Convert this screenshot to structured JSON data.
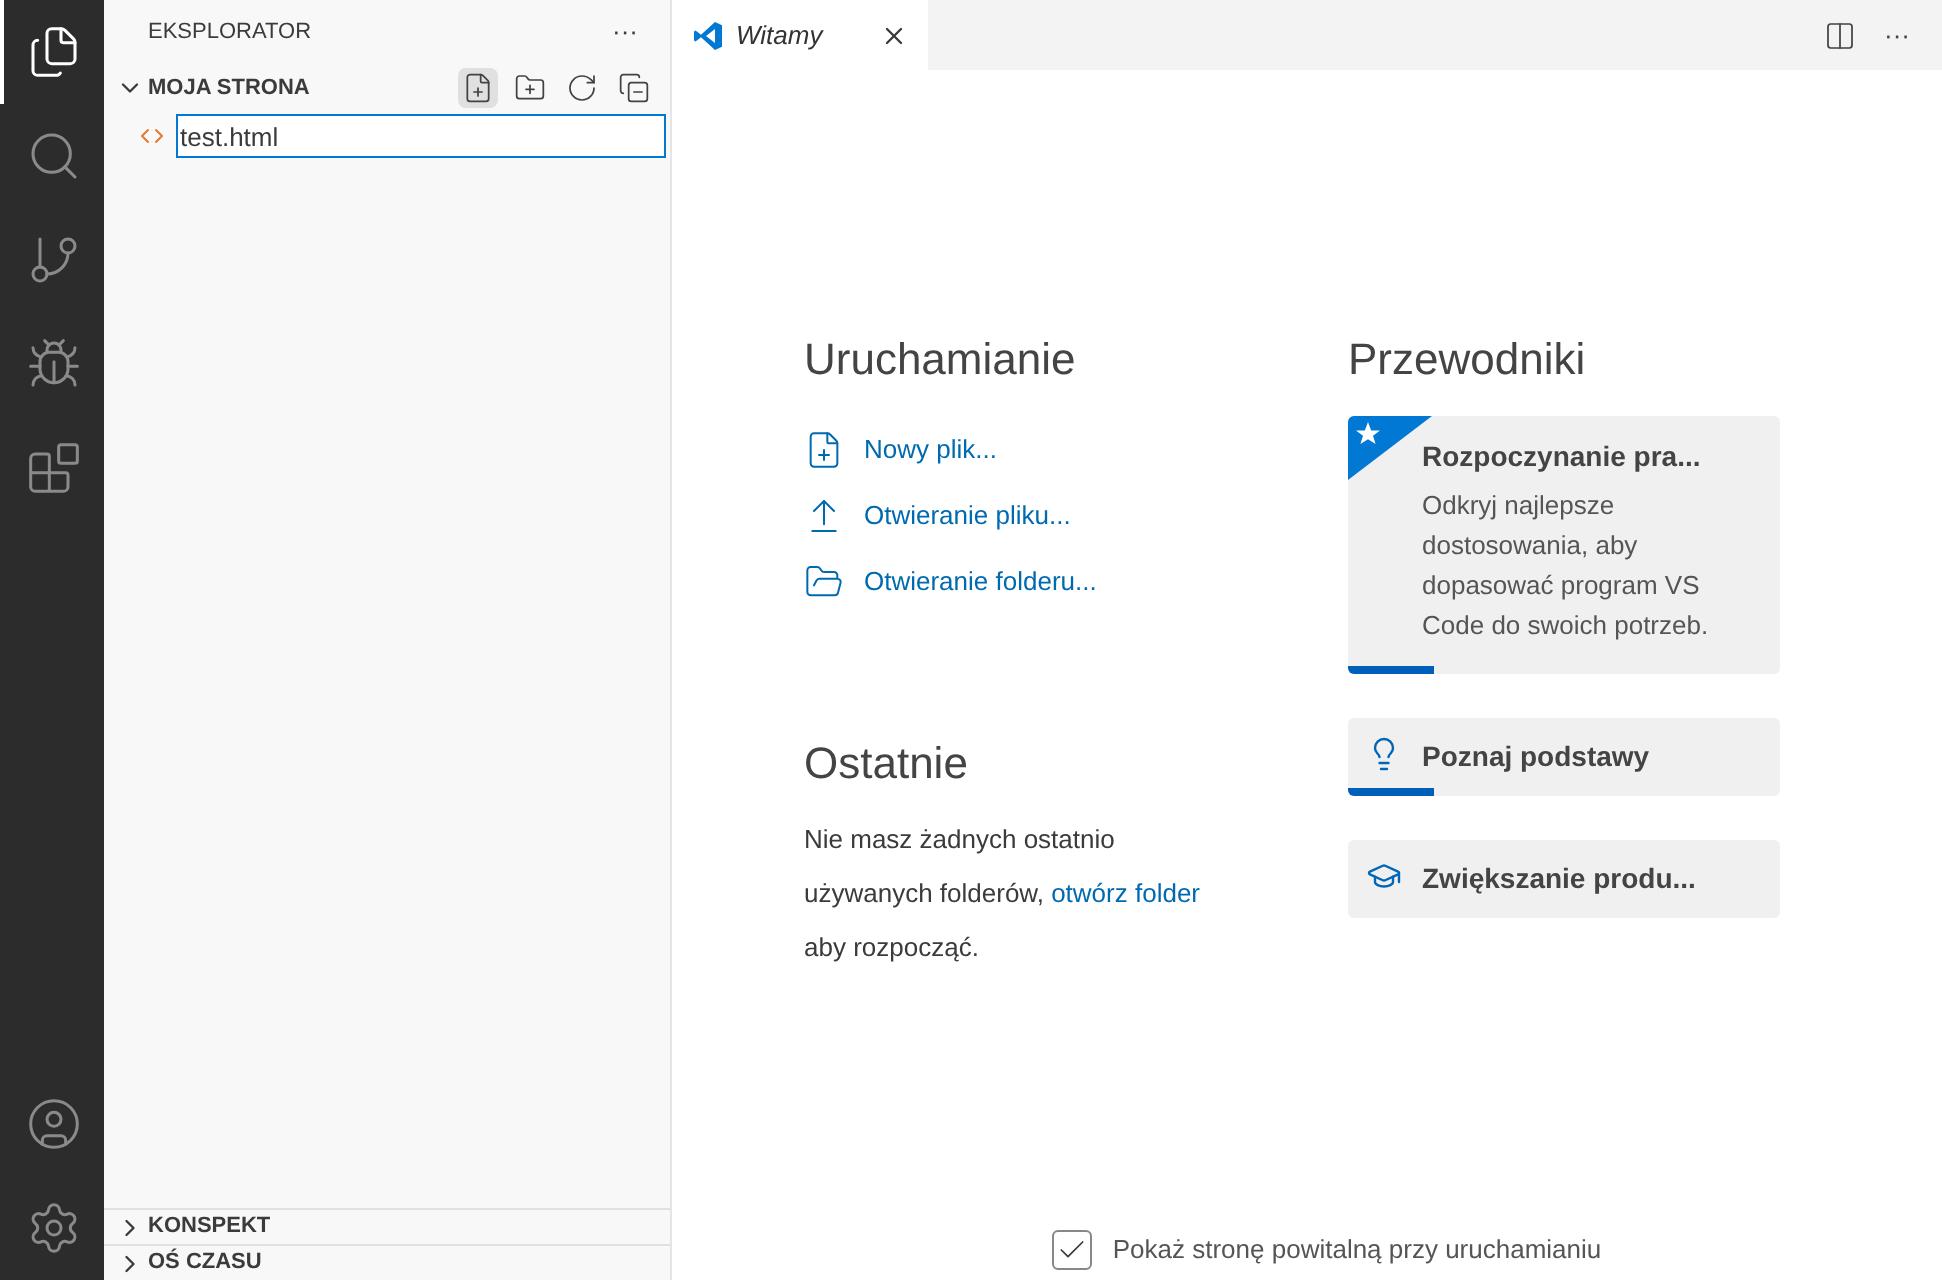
{
  "activity_bar": [
    {
      "kind": "files",
      "selected": true
    },
    {
      "kind": "search",
      "selected": false
    },
    {
      "kind": "source-control",
      "selected": false
    },
    {
      "kind": "run-debug",
      "selected": false
    },
    {
      "kind": "extensions",
      "selected": false
    }
  ],
  "activity_bar_bottom": [
    {
      "kind": "account"
    },
    {
      "kind": "settings"
    }
  ],
  "sidebar": {
    "title": "EKSPLORATOR",
    "more": "···",
    "folder": {
      "name": "MOJA STRONA",
      "expanded": true,
      "new_file_input": {
        "value": "test.html"
      }
    },
    "sections": [
      {
        "name": "KONSPEKT",
        "expanded": false
      },
      {
        "name": "OŚ CZASU",
        "expanded": false
      }
    ]
  },
  "tabs": [
    {
      "label": "Witamy",
      "selected": true
    }
  ],
  "editor_actions_more": "···",
  "welcome": {
    "start": {
      "title": "Uruchamianie",
      "items": [
        {
          "kind": "new-file",
          "label": "Nowy plik..."
        },
        {
          "kind": "open-file",
          "label": "Otwieranie pliku..."
        },
        {
          "kind": "open-folder",
          "label": "Otwieranie folderu..."
        }
      ]
    },
    "recent": {
      "title": "Ostatnie",
      "text_before": "Nie masz żadnych ostatnio używanych folderów,",
      "link": "otwórz folder",
      "text_after": "aby rozpocząć."
    },
    "guides": {
      "title": "Przewodniki",
      "items": [
        {
          "kind": "featured",
          "title": "Rozpoczynanie pra...",
          "description": "Odkryj najlepsze dostosowania, aby dopasować program VS Code do swoich potrzeb.",
          "level": 0.2
        },
        {
          "kind": "bulb",
          "title": "Poznaj podstawy",
          "level": 0.2
        },
        {
          "kind": "mortarboard",
          "title": "Zwiększanie produ..."
        }
      ]
    },
    "show_on_startup": {
      "label": "Pokaż stronę powitalną przy uruchamianiu",
      "checked": true
    }
  }
}
